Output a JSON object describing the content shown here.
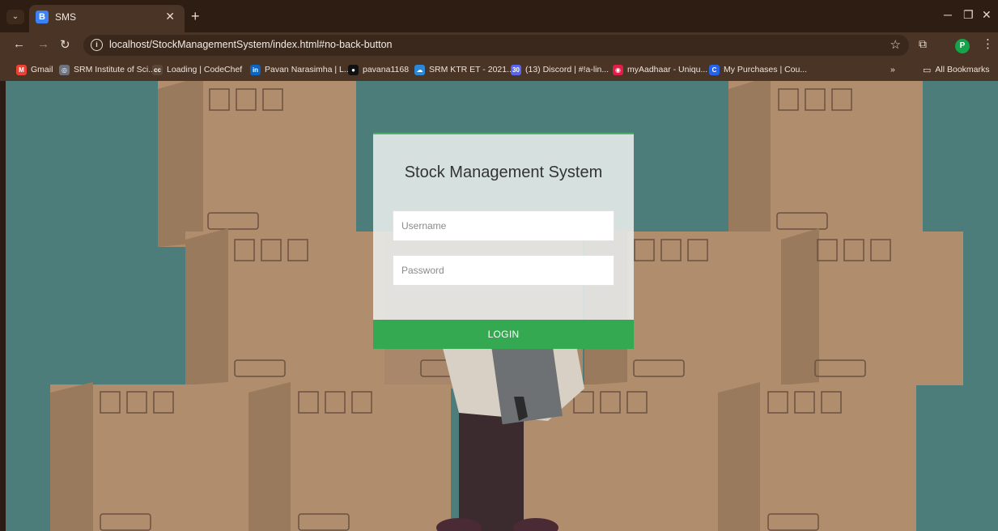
{
  "browser": {
    "tab_title": "SMS",
    "tab_favicon_letter": "B",
    "new_tab_label": "+",
    "url": "localhost/StockManagementSystem/index.html#no-back-button",
    "profile_initial": "P",
    "bookmarks": [
      {
        "label": "Gmail",
        "icon": "gmail-icon",
        "icon_text": "M",
        "color": "#ea4335"
      },
      {
        "label": "SRM Institute of Sci...",
        "icon": "globe-icon",
        "icon_text": "◎",
        "color": "#6b7280"
      },
      {
        "label": "Loading | CodeChef",
        "icon": "codechef-icon",
        "icon_text": "cc",
        "color": "#5b4636"
      },
      {
        "label": "Pavan Narasimha | L...",
        "icon": "linkedin-icon",
        "icon_text": "in",
        "color": "#0a66c2"
      },
      {
        "label": "pavana1168",
        "icon": "github-icon",
        "icon_text": "●",
        "color": "#111111"
      },
      {
        "label": "SRM KTR ET - 2021...",
        "icon": "cloud-icon",
        "icon_text": "☁",
        "color": "#2b88d8"
      },
      {
        "label": "(13) Discord | #!a-lin...",
        "icon": "discord-icon",
        "icon_text": "30",
        "color": "#5865f2"
      },
      {
        "label": "myAadhaar - Uniqu...",
        "icon": "aadhaar-icon",
        "icon_text": "◉",
        "color": "#e11d48"
      },
      {
        "label": "My Purchases | Cou...",
        "icon": "coursera-icon",
        "icon_text": "C",
        "color": "#2563eb"
      }
    ],
    "more_bookmarks": "»",
    "all_bookmarks": "All Bookmarks"
  },
  "login": {
    "title": "Stock Management System",
    "username_placeholder": "Username",
    "password_placeholder": "Password",
    "button_label": "LOGIN"
  },
  "colors": {
    "chrome_dark": "#2e1d12",
    "chrome": "#4a3426",
    "page_bg": "#4d7d7a",
    "box": "#b08d6c",
    "box_side": "#8f6f52",
    "login_button": "#35a852"
  }
}
